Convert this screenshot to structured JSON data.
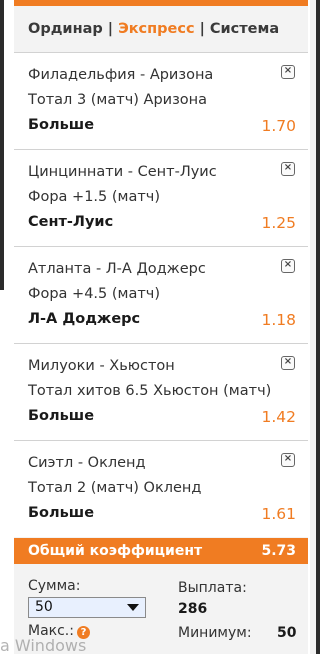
{
  "tabs": [
    {
      "label": "Ординар"
    },
    {
      "label": "Экспресс"
    },
    {
      "label": "Система"
    }
  ],
  "tab_separator": "|",
  "bets": [
    {
      "match": "Филадельфия - Аризона",
      "market": "Тотал 3 (матч) Аризона",
      "pick": "Больше",
      "odds": "1.70"
    },
    {
      "match": "Цинциннати - Сент-Луис",
      "market": "Фора +1.5 (матч)",
      "pick": "Сент-Луис",
      "odds": "1.25"
    },
    {
      "match": "Атланта - Л-А Доджерс",
      "market": "Фора +4.5 (матч)",
      "pick": "Л-А Доджерс",
      "odds": "1.18"
    },
    {
      "match": "Милуоки - Хьюстон",
      "market": "Тотал хитов 6.5 Хьюстон (матч)",
      "pick": "Больше",
      "odds": "1.42"
    },
    {
      "match": "Сиэтл - Окленд",
      "market": "Тотал 2 (матч) Окленд",
      "pick": "Больше",
      "odds": "1.61"
    }
  ],
  "close_icon": "x-box-icon",
  "total": {
    "label": "Общий коэффициент",
    "value": "5.73"
  },
  "stake": {
    "label": "Сумма:",
    "value": "50",
    "max_label": "Макс.:",
    "help": "?"
  },
  "payout": {
    "label": "Выплата:",
    "value": "286",
    "min_label": "Минимум:",
    "min_value": "50"
  },
  "watermark": "а Windows",
  "colors": {
    "accent": "#f07c22",
    "panel": "#f3f3f3"
  }
}
